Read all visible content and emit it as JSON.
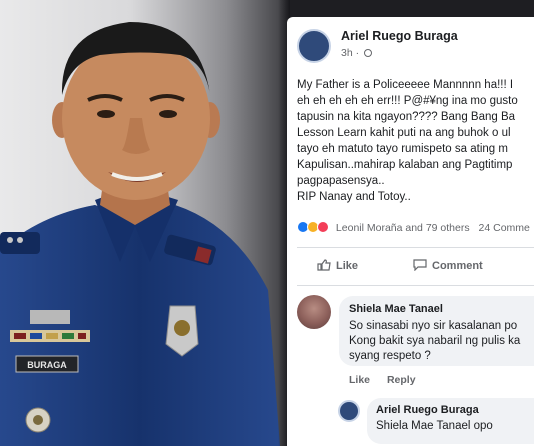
{
  "photo": {
    "subject": "police-officer-portrait",
    "name_tag": "BURAGA",
    "uniform_color": "#1b3a7a",
    "background_color": "#e4e4e6"
  },
  "post": {
    "author": "Ariel Ruego Buraga",
    "time": "3h",
    "lines": [
      "My Father is a Policeeeee Mannnnn ha!!! I",
      "eh eh eh eh eh err!!! P@#¥ng ina mo gusto",
      "tapusin na kita ngayon???? Bang Bang Ba",
      "Lesson Learn kahit puti na ang buhok o ul",
      "tayo eh matuto tayo rumispeto sa ating m",
      "Kapulisan..mahirap kalaban ang Pagtitimp",
      "pagpapasensya..",
      "RIP Nanay and Totoy.."
    ],
    "reactions_text": "Leonil Moraña and 79 others",
    "comments_text": "24 Comme",
    "reaction_colors": {
      "like": "#1877f2",
      "sad": "#f7b125",
      "love": "#f33e58"
    },
    "actions": {
      "like": "Like",
      "comment": "Comment"
    }
  },
  "comments": [
    {
      "name": "Shiela Mae Tanael",
      "lines": [
        "So sinasabi nyo sir kasalanan po",
        "Kong bakit sya nabaril ng pulis ka",
        "syang respeto ?"
      ],
      "actions": {
        "like": "Like",
        "reply": "Reply"
      }
    },
    {
      "name": "Ariel Ruego Buraga",
      "mention": "Shiela Mae Tanael",
      "text": " opo"
    }
  ]
}
